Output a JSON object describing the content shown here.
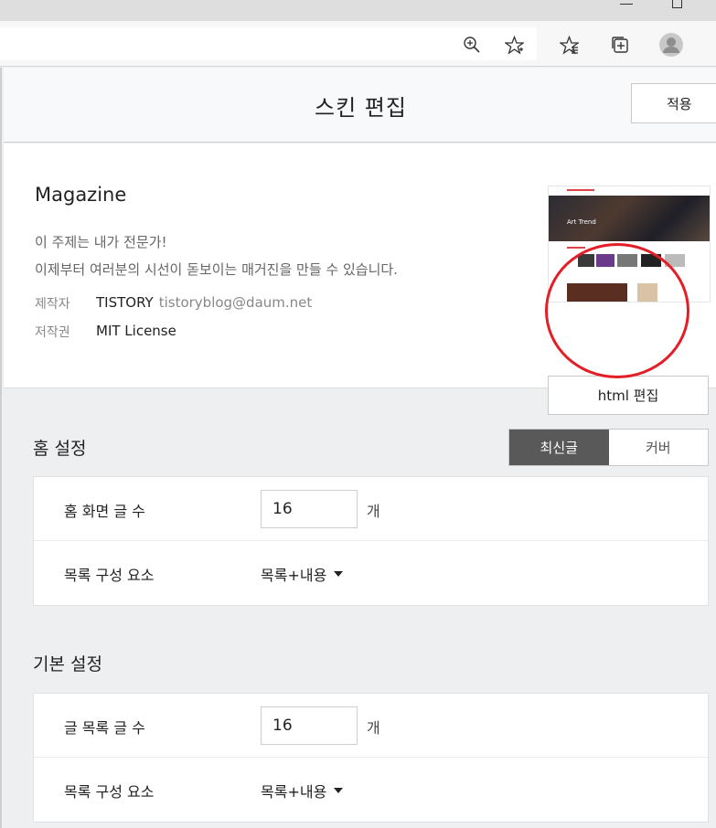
{
  "page": {
    "title": "스킨 편집",
    "apply_label": "적용"
  },
  "skin": {
    "name": "Magazine",
    "desc_line1": "이 주제는 내가 전문가!",
    "desc_line2": "이제부터 여러분의 시선이 돋보이는 매거진을 만들 수 있습니다.",
    "author_key": "제작자",
    "author_name": "TISTORY",
    "author_email": "tistoryblog@daum.net",
    "license_key": "저작권",
    "license_value": "MIT License",
    "thumbnail_title": "Art Trend",
    "html_edit_label": "html 편집"
  },
  "home_settings": {
    "title": "홈 설정",
    "tabs": [
      "최신글",
      "커버"
    ],
    "active_tab": "최신글",
    "rows": [
      {
        "label": "홈 화면 글 수",
        "value": "16",
        "unit": "개"
      },
      {
        "label": "목록 구성 요소",
        "select": "목록+내용"
      }
    ]
  },
  "basic_settings": {
    "title": "기본 설정",
    "rows": [
      {
        "label": "글 목록 글 수",
        "value": "16",
        "unit": "개"
      },
      {
        "label": "목록 구성 요소",
        "select": "목록+내용"
      }
    ]
  },
  "colors": {
    "active_tab_bg": "#595959",
    "annotation": "#e41e26"
  }
}
